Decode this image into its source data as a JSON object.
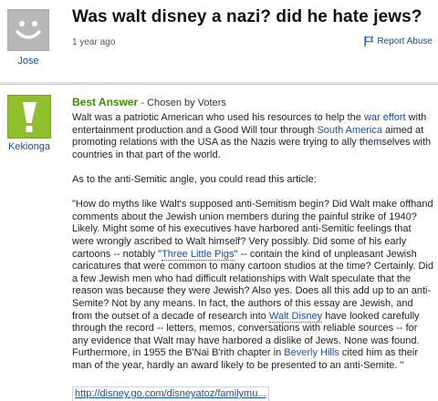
{
  "question": {
    "title": "Was walt disney a nazi? did he hate jews?",
    "time": "1 year ago",
    "report": "Report Abuse",
    "asker": "Jose"
  },
  "answer": {
    "best_label": "Best Answer",
    "chosen_by": "- Chosen by Voters",
    "answerer": "Kekionga",
    "p1": {
      "a": "Walt was a patriotic American who used his resources to help the ",
      "link1": "war effort",
      "b": " with entertainment production and a Good Will tour through ",
      "link2": "South America",
      "c": " aimed at promoting relations with the USA as the Nazis were trying to ally themselves with countries in that part of the world."
    },
    "p2": "As to the anti-Semitic angle, you could read this article:",
    "quote": {
      "a": "\"How do myths like Walt's supposed anti-Semitism begin? Did Walt make offhand comments about the Jewish union members during the painful strike of 1940? Likely. Might some of his executives have harbored anti-Semitic feelings that were wrongly ascribed to Walt himself? Very possibly. Did some of his early cartoons -- notably \"",
      "link1": "Three Little Pigs",
      "b": "\" -- contain the kind of unpleasant Jewish caricatures that were common to many cartoon studios at the time? Certainly. Did a few Jewish men who had difficult relationships with Walt speculate that the reason was because they were Jewish? Also yes. Does all this add up to an anti-Semite? Not by any means. In fact, the authors of this essay are Jewish, and from the outset of a decade of research into ",
      "link2": "Walt Disney",
      "c": " have looked carefully through the record -- letters, memos, conversations with reliable sources -- for any evidence that Walt may have harbored a dislike of Jews. None was found. Furthermore, in 1955 the B'Nai B'rith chapter in ",
      "link3": "Beverly Hills",
      "d": " cited him as their man of the year, hardly an award likely to be presented to an anti-Semite. \""
    },
    "source": "http://disney.go.com/disneyatoz/familymu..."
  },
  "colors": {
    "best_answer": "#3d8f00",
    "link": "#1a4fa3",
    "avatar_answerer": "#8fbf2a",
    "avatar_asker": "#b8b8b8"
  },
  "icons": {
    "asker_avatar": "smiley-face-avatar",
    "answerer_avatar": "exclamation-avatar",
    "report": "flag-icon"
  }
}
